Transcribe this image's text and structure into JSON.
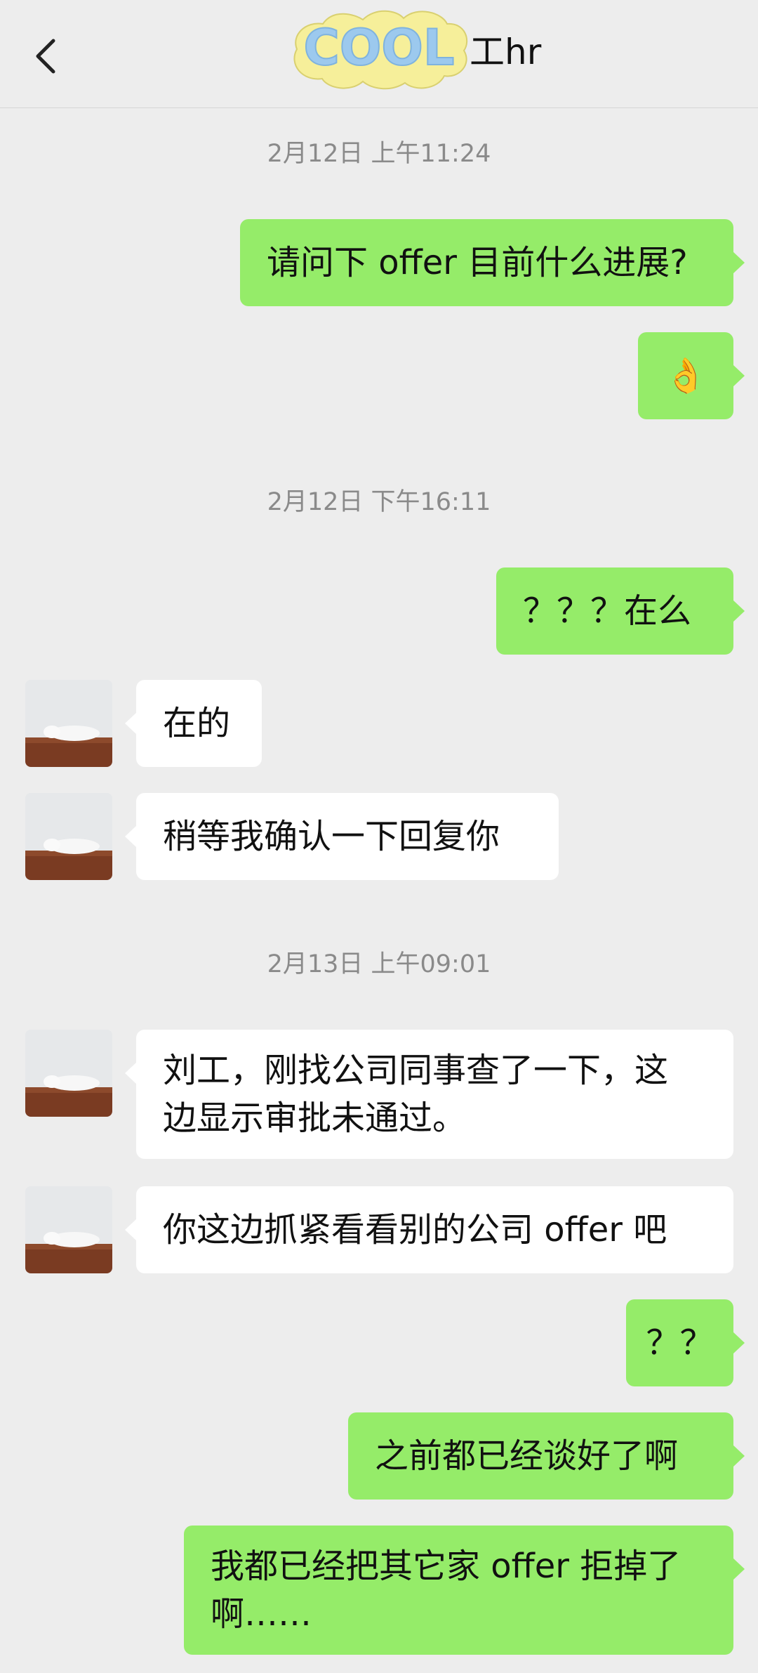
{
  "header": {
    "logo_text": "COOL",
    "title": "工hr"
  },
  "icons": {
    "back": "chevron-left-icon",
    "logo": "cool-bubble-logo",
    "emoji": "ok-hand-emoji"
  },
  "colors": {
    "background": "#ededed",
    "my_bubble": "#95ec69",
    "their_bubble": "#ffffff",
    "timestamp_text": "#8a8a8a"
  },
  "chat": {
    "timestamps": [
      "2月12日 上午11:24",
      "2月12日 下午16:11",
      "2月13日 上午09:01"
    ],
    "messages": [
      {
        "sender": "me",
        "text": "请问下 offer 目前什么进展?"
      },
      {
        "sender": "me",
        "text": "👌"
      },
      {
        "sender": "me",
        "text": "？？？在么"
      },
      {
        "sender": "hr",
        "text": "在的"
      },
      {
        "sender": "hr",
        "text": "稍等我确认一下回复你"
      },
      {
        "sender": "hr",
        "text": "刘工，刚找公司同事查了一下，这\n边显示审批未通过。"
      },
      {
        "sender": "hr",
        "text": "你这边抓紧看看别的公司 offer 吧"
      },
      {
        "sender": "me",
        "text": "？？"
      },
      {
        "sender": "me",
        "text": "之前都已经谈好了啊"
      },
      {
        "sender": "me",
        "text": "我都已经把其它家 offer 拒掉了\n啊……"
      }
    ]
  }
}
